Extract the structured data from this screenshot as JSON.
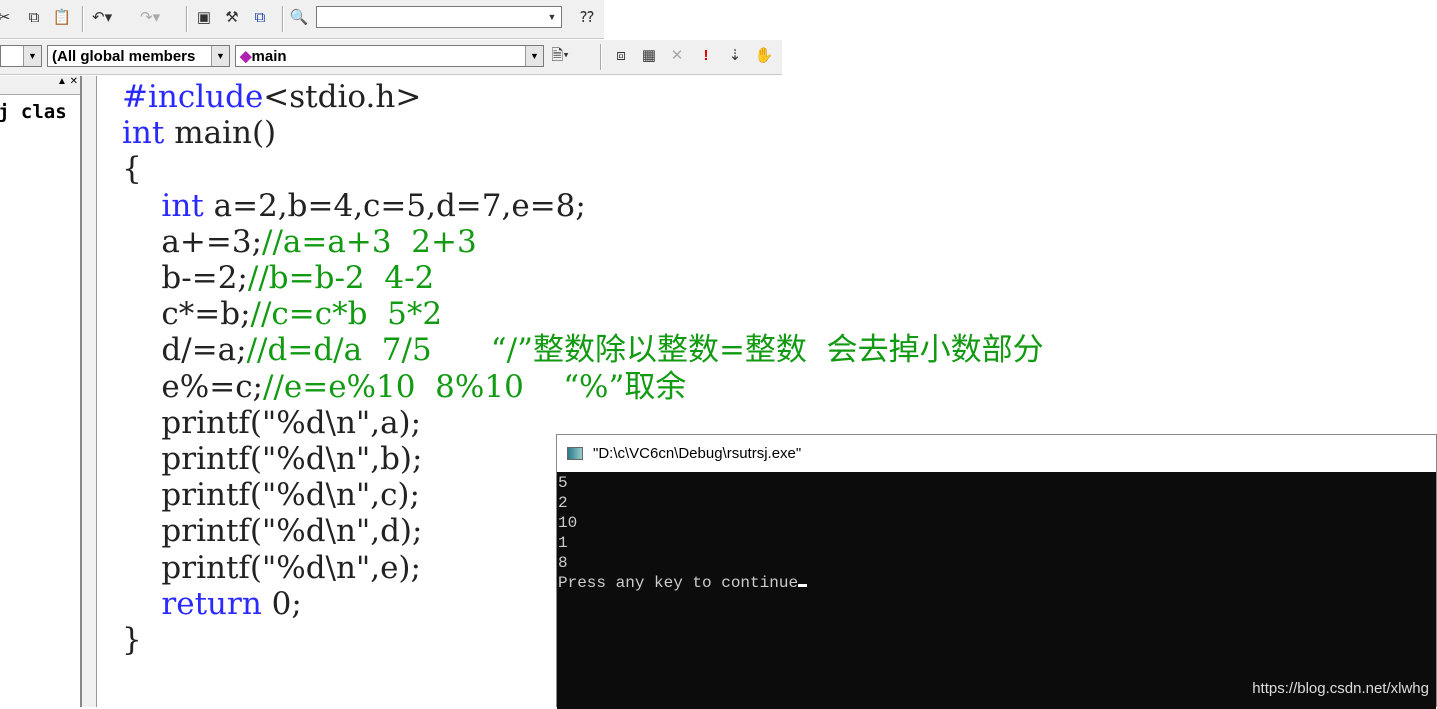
{
  "toolbar": {
    "find_combo_value": "",
    "class_combo": "(All global members",
    "function_combo": "main"
  },
  "left_panel": {
    "text": "j clas"
  },
  "code_colors": {
    "keyword": "#2a2aff",
    "comment": "#129a12",
    "text": "#222222"
  },
  "code": [
    [
      {
        "t": "#include",
        "c": "keyword"
      },
      {
        "t": "<stdio.h>",
        "c": "text"
      }
    ],
    [
      {
        "t": "int",
        "c": "keyword"
      },
      {
        "t": " main()",
        "c": "text"
      }
    ],
    [
      {
        "t": "{",
        "c": "text"
      }
    ],
    [
      {
        "t": "    ",
        "c": "text"
      },
      {
        "t": "int",
        "c": "keyword"
      },
      {
        "t": " a=2,b=4,c=5,d=7,e=8;",
        "c": "text"
      }
    ],
    [
      {
        "t": "    a+=3;",
        "c": "text"
      },
      {
        "t": "//a=a+3  2+3",
        "c": "comment"
      }
    ],
    [
      {
        "t": "    b-=2;",
        "c": "text"
      },
      {
        "t": "//b=b-2  4-2",
        "c": "comment"
      }
    ],
    [
      {
        "t": "    c*=b;",
        "c": "text"
      },
      {
        "t": "//c=c*b  5*2",
        "c": "comment"
      }
    ],
    [
      {
        "t": "    d/=a;",
        "c": "text"
      },
      {
        "t": "//d=d/a  7/5      “/”整数除以整数=整数  会去掉小数部分",
        "c": "comment"
      }
    ],
    [
      {
        "t": "    e%=c;",
        "c": "text"
      },
      {
        "t": "//e=e%10  8%10    “%”取余",
        "c": "comment"
      }
    ],
    [
      {
        "t": "    printf(\"%d\\n\",a);",
        "c": "text"
      }
    ],
    [
      {
        "t": "    printf(\"%d\\n\",b);",
        "c": "text"
      }
    ],
    [
      {
        "t": "    printf(\"%d\\n\",c);",
        "c": "text"
      }
    ],
    [
      {
        "t": "    printf(\"%d\\n\",d);",
        "c": "text"
      }
    ],
    [
      {
        "t": "    printf(\"%d\\n\",e);",
        "c": "text"
      }
    ],
    [
      {
        "t": "    ",
        "c": "text"
      },
      {
        "t": "return",
        "c": "keyword"
      },
      {
        "t": " 0;",
        "c": "text"
      }
    ],
    [
      {
        "t": "}",
        "c": "text"
      }
    ]
  ],
  "console": {
    "title": "\"D:\\c\\VC6cn\\Debug\\rsutrsj.exe\"",
    "lines": [
      "5",
      "2",
      "10",
      "1",
      "8",
      "Press any key to continue"
    ]
  },
  "watermark": "https://blog.csdn.net/xlwhg"
}
